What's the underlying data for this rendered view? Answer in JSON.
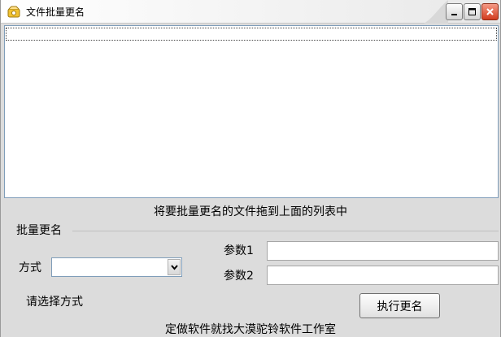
{
  "window": {
    "title": "文件批量更名",
    "controls": {
      "minimize": "minimize",
      "maximize": "maximize",
      "close": "close"
    }
  },
  "file_list": {
    "items": []
  },
  "hint_text": "将要批量更名的文件拖到上面的列表中",
  "group": {
    "title": "批量更名",
    "mode_label": "方式",
    "mode_value": "",
    "param1_label": "参数1",
    "param1_value": "",
    "param2_label": "参数2",
    "param2_value": "",
    "status_text": "请选择方式",
    "run_button": "执行更名"
  },
  "footer_text": "定做软件就找大漠驼铃软件工作室",
  "icons": [
    "app-icon",
    "minimize-icon",
    "maximize-icon",
    "close-icon",
    "chevron-down-icon"
  ],
  "colors": {
    "close_button": "#d23c1e",
    "list_border": "#7f9db9"
  }
}
